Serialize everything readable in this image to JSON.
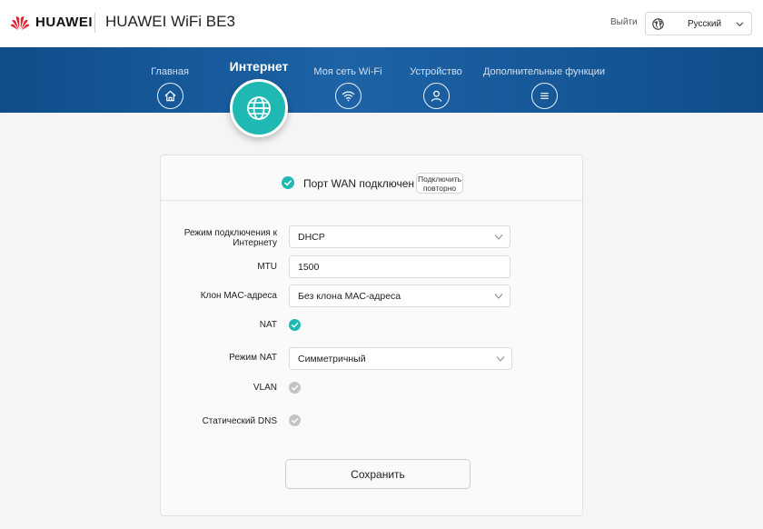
{
  "header": {
    "brand": "HUAWEI",
    "product": "HUAWEI WiFi BE3",
    "logout": "Выйти",
    "language": "Русский"
  },
  "nav": {
    "items": [
      {
        "label": "Главная",
        "icon": "home-icon"
      },
      {
        "label": "Интернет",
        "icon": "globe-icon",
        "active": true
      },
      {
        "label": "Моя сеть Wi-Fi",
        "icon": "wifi-icon"
      },
      {
        "label": "Устройство",
        "icon": "user-icon"
      },
      {
        "label": "Дополнительные функции",
        "icon": "menu-icon"
      }
    ]
  },
  "status": {
    "text": "Порт WAN подключен",
    "reconnect_line1": "Подключить",
    "reconnect_line2": "повторно"
  },
  "form": {
    "connection_mode": {
      "label": "Режим подключения к Интернету",
      "value": "DHCP"
    },
    "mtu": {
      "label": "MTU",
      "value": "1500"
    },
    "mac_clone": {
      "label": "Клон MAC-адреса",
      "value": "Без клона MAC-адреса"
    },
    "nat": {
      "label": "NAT",
      "checked": true
    },
    "nat_mode": {
      "label": "Режим NAT",
      "value": "Симметричный"
    },
    "vlan": {
      "label": "VLAN",
      "checked": false
    },
    "static_dns": {
      "label": "Статический DNS",
      "checked": false
    }
  },
  "actions": {
    "save": "Сохранить"
  },
  "colors": {
    "accent": "#1fb8b2",
    "nav_band": "#1d63a6",
    "brand_red": "#e0202c",
    "check_disabled": "#c4c4c4"
  }
}
